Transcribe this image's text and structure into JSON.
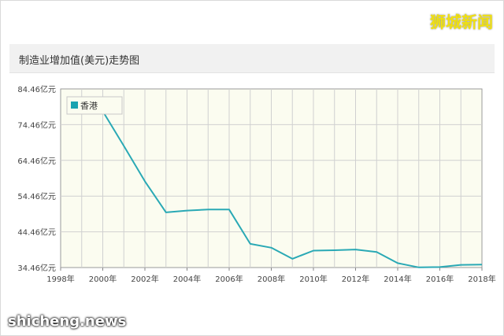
{
  "brand": "狮城新闻",
  "header_title": "制造业增加值(美元)走势图",
  "watermark": "shicheng.news",
  "colors": {
    "series": "#2aa9b5",
    "plot_bg": "#fbfcf0",
    "grid": "#d0d0d0",
    "legend_swatch": "#1aa3b0"
  },
  "chart_data": {
    "type": "line",
    "title": "制造业增加值(美元)走势图",
    "xlabel": "",
    "ylabel": "",
    "x_ticks": [
      "1998年",
      "2000年",
      "2002年",
      "2004年",
      "2006年",
      "2008年",
      "2010年",
      "2012年",
      "2014年",
      "2016年",
      "2018年"
    ],
    "y_ticks": [
      "34.46亿元",
      "44.46亿元",
      "54.46亿元",
      "64.46亿元",
      "74.46亿元",
      "84.46亿元"
    ],
    "xlim": [
      1998,
      2018
    ],
    "ylim": [
      34.46,
      84.46
    ],
    "grid": true,
    "legend_position": "top-left",
    "series": [
      {
        "name": "香港",
        "x": [
          2000,
          2001,
          2002,
          2003,
          2004,
          2005,
          2006,
          2007,
          2008,
          2009,
          2010,
          2011,
          2012,
          2013,
          2014,
          2015,
          2016,
          2017,
          2018
        ],
        "y": [
          78.2,
          68.5,
          58.6,
          49.9,
          50.4,
          50.7,
          50.7,
          41.1,
          40.0,
          36.9,
          39.2,
          39.3,
          39.5,
          38.8,
          35.7,
          34.5,
          34.6,
          35.2,
          35.3
        ]
      }
    ]
  }
}
